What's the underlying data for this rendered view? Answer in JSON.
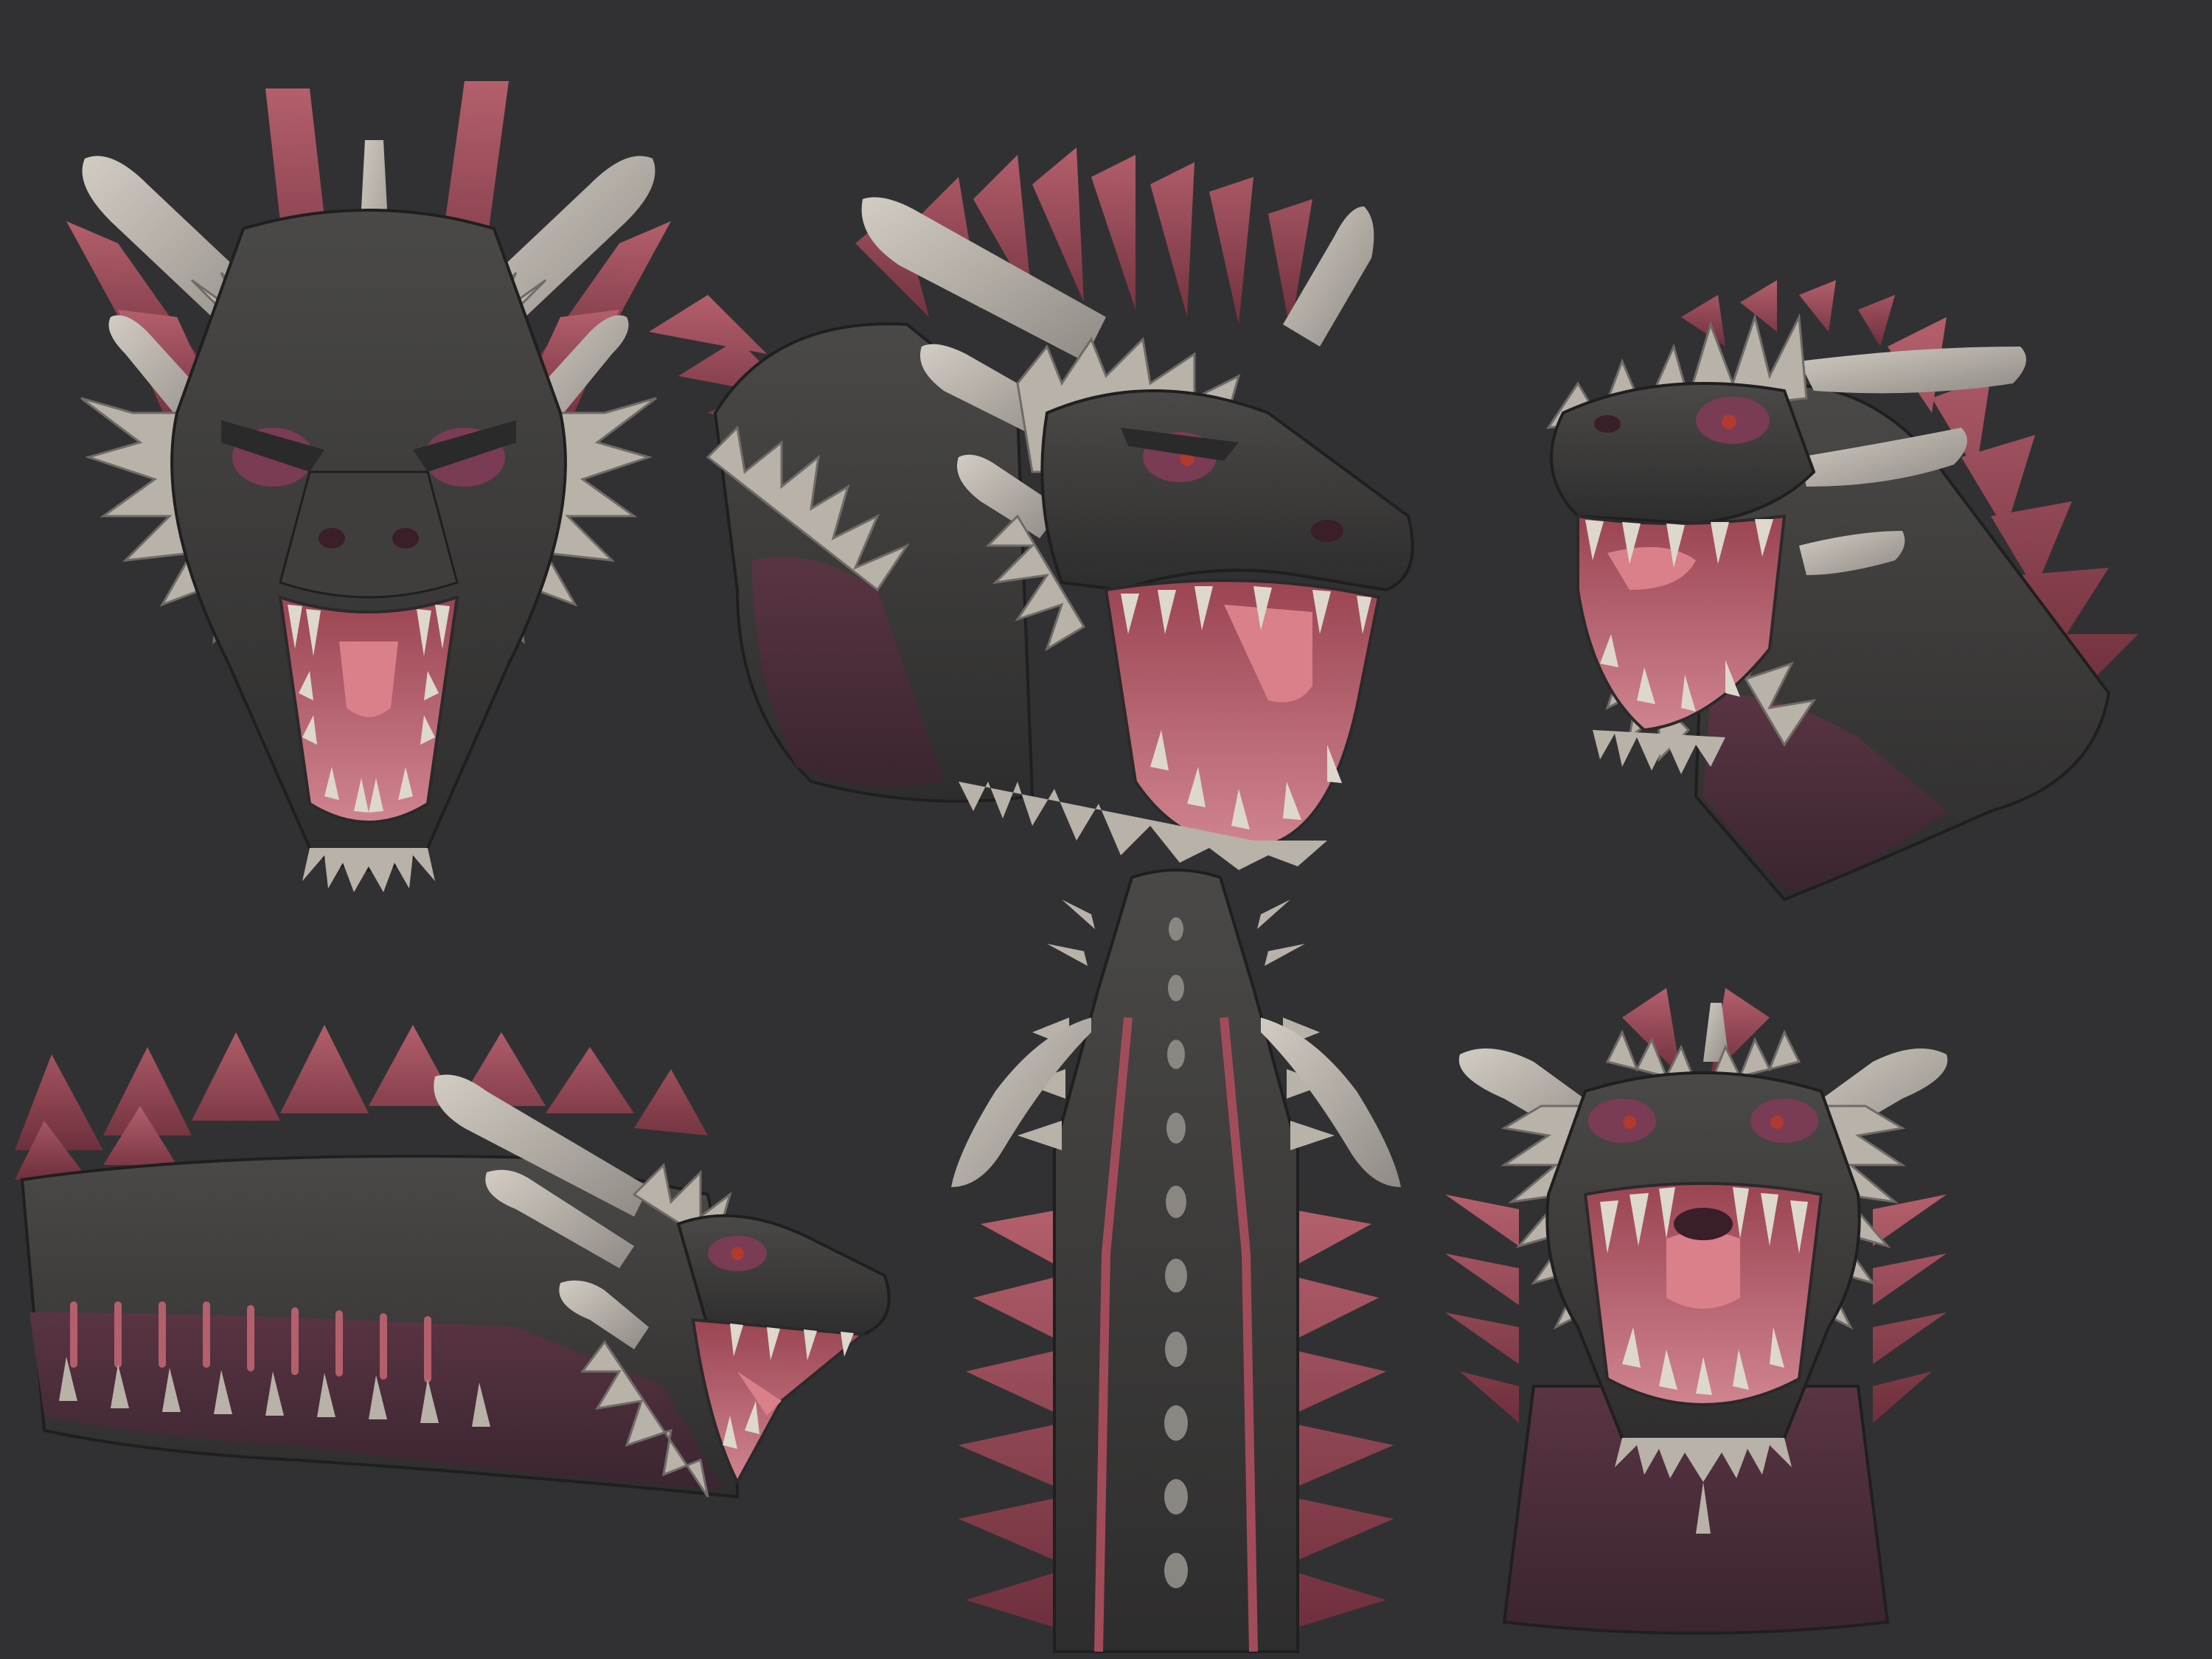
{
  "sheet": {
    "background": "#313133",
    "subject": "dragon-head-sculpt",
    "views": [
      {
        "name": "front-view",
        "mouth": "open"
      },
      {
        "name": "three-quarter-view",
        "mouth": "open"
      },
      {
        "name": "three-quarter-rear-view",
        "mouth": "open"
      },
      {
        "name": "side-profile-view",
        "mouth": "open"
      },
      {
        "name": "top-view",
        "mouth": "closed"
      },
      {
        "name": "low-front-view",
        "mouth": "open"
      }
    ]
  },
  "palette": {
    "skin": "#3b3b3a",
    "skin_highlight": "#5a5856",
    "horn": "#a9a39c",
    "horn_highlight": "#cfc9c0",
    "frill": "#8c3c4a",
    "frill_light": "#b25c68",
    "mouth": "#b95f6c",
    "tongue": "#d9808a",
    "teeth": "#ddd7cc",
    "eye_socket": "#7a3b55",
    "throat": "#4d2d3a"
  }
}
